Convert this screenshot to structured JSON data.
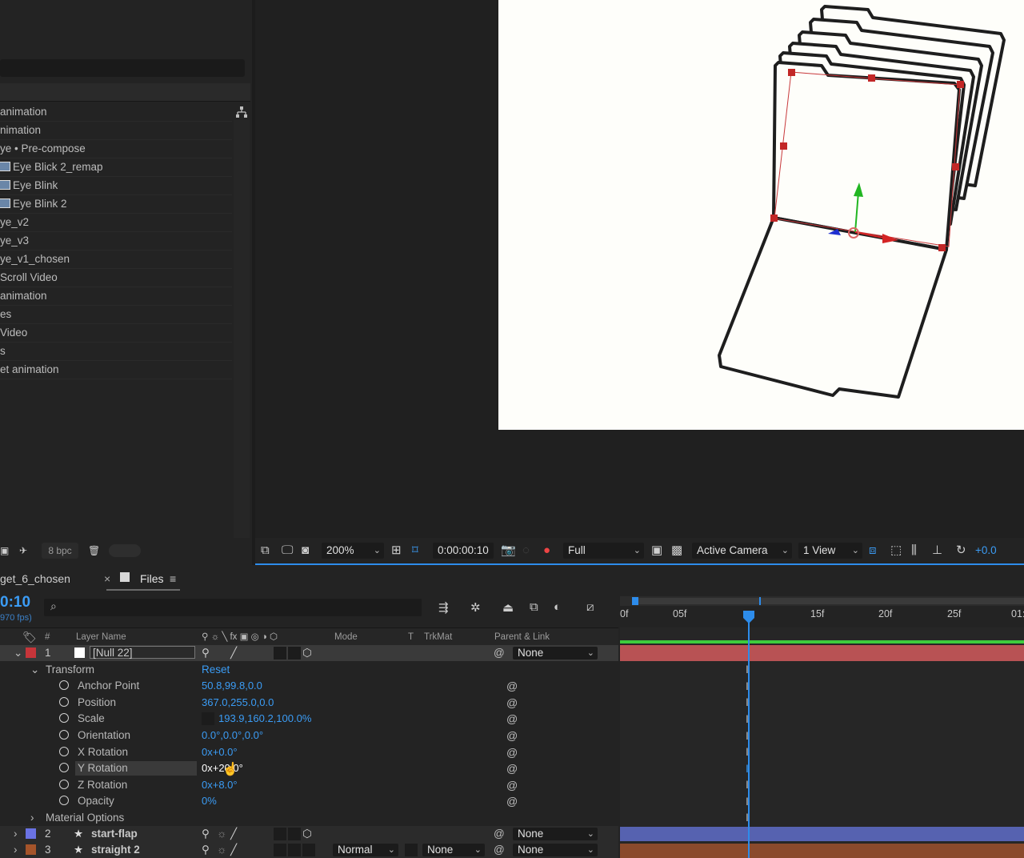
{
  "project": {
    "items": [
      {
        "label": "animation",
        "icon": "none"
      },
      {
        "label": "nimation",
        "icon": "none"
      },
      {
        "label": "ye • Pre-compose",
        "icon": "none"
      },
      {
        "label": "Eye Blick 2_remap",
        "icon": "composition-icon"
      },
      {
        "label": "Eye Blink",
        "icon": "composition-icon"
      },
      {
        "label": "Eye Blink 2",
        "icon": "composition-icon"
      },
      {
        "label": "ye_v2",
        "icon": "none"
      },
      {
        "label": "ye_v3",
        "icon": "none"
      },
      {
        "label": "ye_v1_chosen",
        "icon": "none"
      },
      {
        "label": " Scroll Video",
        "icon": "none"
      },
      {
        "label": "animation",
        "icon": "none"
      },
      {
        "label": "es",
        "icon": "none"
      },
      {
        "label": "Video",
        "icon": "none"
      },
      {
        "label": "s",
        "icon": "none"
      },
      {
        "label": "et animation",
        "icon": "none"
      }
    ],
    "bpc_label": "8 bpc"
  },
  "viewer_toolbar": {
    "zoom": "200%",
    "timecode": "0:00:00:10",
    "resolution": "Full",
    "camera": "Active Camera",
    "views": "1 View",
    "exposure": "+0.0"
  },
  "timeline": {
    "tabs": [
      "get_6_chosen",
      "Files"
    ],
    "close_glyph": "×",
    "menu_glyph": "≡",
    "current_time": "0:10",
    "fps": "970 fps)",
    "columns": {
      "number": "#",
      "layer_name": "Layer Name",
      "mode": "Mode",
      "t": "T",
      "trkmat": "TrkMat",
      "parent": "Parent & Link"
    },
    "layers": [
      {
        "num": "1",
        "name": "[Null 22]",
        "color": "#c7353a",
        "parent": "None"
      },
      {
        "num": "2",
        "name": "start-flap",
        "color": "#6a72e3",
        "parent": "None"
      },
      {
        "num": "3",
        "name": "straight 2",
        "color": "#a5542a",
        "mode": "Normal",
        "trkmat": "None",
        "parent": "None"
      }
    ],
    "transform_label": "Transform",
    "reset_label": "Reset",
    "properties": [
      {
        "name": "Anchor Point",
        "value": "50.8,99.8,0.0"
      },
      {
        "name": "Position",
        "value": "367.0,255.0,0.0"
      },
      {
        "name": "Scale",
        "value": "193.9,160.2,100.0%"
      },
      {
        "name": "Orientation",
        "value": "0.0°,0.0°,0.0°"
      },
      {
        "name": "X Rotation",
        "value": "0x+0.0°"
      },
      {
        "name": "Y Rotation",
        "value": "0x+20.0°"
      },
      {
        "name": "Z Rotation",
        "value": "0x+8.0°"
      },
      {
        "name": "Opacity",
        "value": "0%"
      }
    ],
    "material_options_label": "Material Options",
    "ruler_ticks": [
      "0f",
      "05f",
      "15f",
      "20f",
      "25f",
      "01:"
    ],
    "colors": {
      "accent": "#2d8ceb",
      "layer1_bar": "#b85254",
      "layer2_bar": "#5662b0",
      "layer3_bar": "#8a4a2c",
      "green": "#3dcc3d"
    }
  }
}
